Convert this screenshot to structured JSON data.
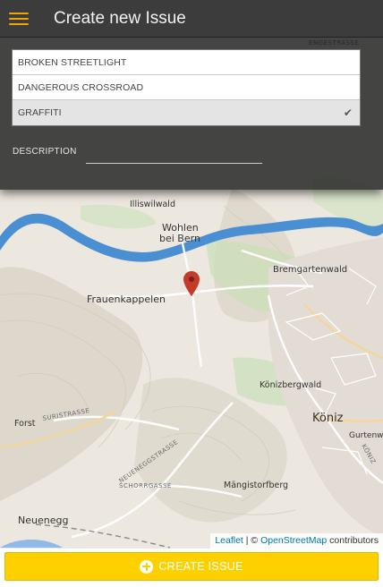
{
  "app_bar": {
    "title": "Create new Issue",
    "menu_icon": "hamburger-menu-icon",
    "menu_color": "#f0a500"
  },
  "categories": {
    "items": [
      {
        "label": "BROKEN STREETLIGHT",
        "selected": false
      },
      {
        "label": "DANGEROUS CROSSROAD",
        "selected": false
      },
      {
        "label": "GRAFFITI",
        "selected": true
      }
    ],
    "check_icon": "checkmark-icon"
  },
  "description": {
    "label": "DESCRIPTION",
    "value": "",
    "placeholder": ""
  },
  "map": {
    "places": [
      "Illiswilwald",
      "Wohlen",
      "bei Bern",
      "Bremgartenwald",
      "Frauenkappelen",
      "Könizbergwald",
      "Forst",
      "Köniz",
      "Gurtenw",
      "Mängistorfberg",
      "Neuenegg"
    ],
    "streets": [
      "SURISTRASSE",
      "NEUENEGGSTRASSE",
      "SCHORRGASSE",
      "KÖNIZ",
      "ENGESTRASSE"
    ],
    "marker_icon": "map-marker-icon",
    "marker_color": "#c43b2b",
    "water_color": "#4a8fd1"
  },
  "attribution": {
    "leaflet_label": "Leaflet",
    "separator": " | © ",
    "osm_label": "OpenStreetMap",
    "suffix": " contributors"
  },
  "create_button": {
    "label": "CREATE ISSUE",
    "icon": "plus-circle-icon",
    "color": "#ffd000"
  }
}
